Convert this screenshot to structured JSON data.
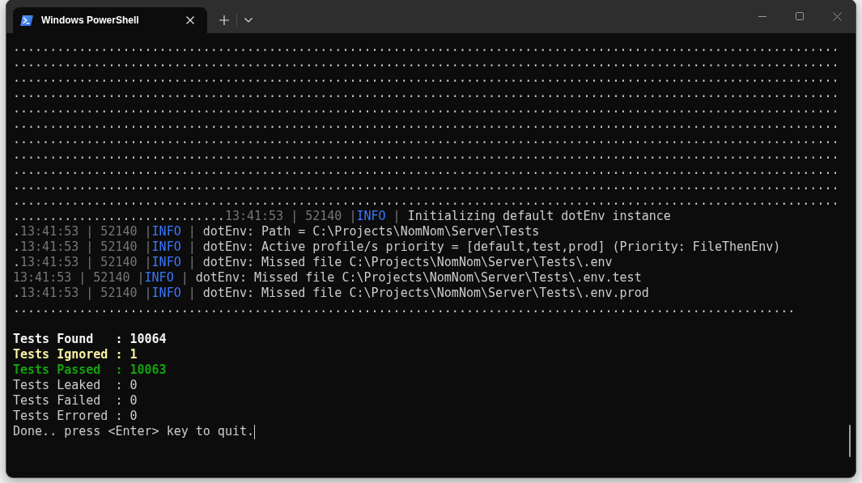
{
  "window": {
    "tab": {
      "title": "Windows PowerShell",
      "selected": true
    }
  },
  "console": {
    "lines": [
      {
        "segments": [
          {
            "kind": "plain",
            "text": "................................................................................................................."
          }
        ]
      },
      {
        "segments": [
          {
            "kind": "plain",
            "text": "................................................................................................................."
          }
        ]
      },
      {
        "segments": [
          {
            "kind": "plain",
            "text": "................................................................................................................."
          }
        ]
      },
      {
        "segments": [
          {
            "kind": "plain",
            "text": "................................................................................................................."
          }
        ]
      },
      {
        "segments": [
          {
            "kind": "plain",
            "text": "................................................................................................................."
          }
        ]
      },
      {
        "segments": [
          {
            "kind": "plain",
            "text": "................................................................................................................."
          }
        ]
      },
      {
        "segments": [
          {
            "kind": "plain",
            "text": "................................................................................................................."
          }
        ]
      },
      {
        "segments": [
          {
            "kind": "plain",
            "text": "................................................................................................................."
          }
        ]
      },
      {
        "segments": [
          {
            "kind": "plain",
            "text": "................................................................................................................."
          }
        ]
      },
      {
        "segments": [
          {
            "kind": "plain",
            "text": "................................................................................................................."
          }
        ]
      },
      {
        "segments": [
          {
            "kind": "plain",
            "text": "................................................................................................................."
          }
        ]
      },
      {
        "segments": [
          {
            "kind": "plain",
            "text": "............................."
          },
          {
            "kind": "dim",
            "text": "13:41:53 | 52140 |"
          },
          {
            "kind": "info",
            "text": "INFO"
          },
          {
            "kind": "dim",
            "text": " | "
          },
          {
            "kind": "plain",
            "text": "Initializing default dotEnv instance"
          }
        ]
      },
      {
        "segments": [
          {
            "kind": "plain",
            "text": "."
          },
          {
            "kind": "dim",
            "text": "13:41:53 | 52140 |"
          },
          {
            "kind": "info",
            "text": "INFO"
          },
          {
            "kind": "dim",
            "text": " | "
          },
          {
            "kind": "plain",
            "text": "dotEnv: Path = C:\\Projects\\NomNom\\Server\\Tests"
          }
        ]
      },
      {
        "segments": [
          {
            "kind": "plain",
            "text": "."
          },
          {
            "kind": "dim",
            "text": "13:41:53 | 52140 |"
          },
          {
            "kind": "info",
            "text": "INFO"
          },
          {
            "kind": "dim",
            "text": " | "
          },
          {
            "kind": "plain",
            "text": "dotEnv: Active profile/s priority = [default,test,prod] (Priority: FileThenEnv)"
          }
        ]
      },
      {
        "segments": [
          {
            "kind": "plain",
            "text": "."
          },
          {
            "kind": "dim",
            "text": "13:41:53 | 52140 |"
          },
          {
            "kind": "info",
            "text": "INFO"
          },
          {
            "kind": "dim",
            "text": " | "
          },
          {
            "kind": "plain",
            "text": "dotEnv: Missed file C:\\Projects\\NomNom\\Server\\Tests\\.env"
          }
        ]
      },
      {
        "segments": [
          {
            "kind": "dim",
            "text": "13:41:53 | 52140 |"
          },
          {
            "kind": "info",
            "text": "INFO"
          },
          {
            "kind": "dim",
            "text": " | "
          },
          {
            "kind": "plain",
            "text": "dotEnv: Missed file C:\\Projects\\NomNom\\Server\\Tests\\.env.test"
          }
        ]
      },
      {
        "segments": [
          {
            "kind": "plain",
            "text": "."
          },
          {
            "kind": "dim",
            "text": "13:41:53 | 52140 |"
          },
          {
            "kind": "info",
            "text": "INFO"
          },
          {
            "kind": "dim",
            "text": " | "
          },
          {
            "kind": "plain",
            "text": "dotEnv: Missed file C:\\Projects\\NomNom\\Server\\Tests\\.env.prod"
          }
        ]
      },
      {
        "segments": [
          {
            "kind": "plain",
            "text": "..........................................................................................................."
          }
        ]
      }
    ],
    "summary": [
      {
        "text": "Tests Found   : 10064",
        "color": "#f2f2f2",
        "bold": true
      },
      {
        "text": "Tests Ignored : 1",
        "color": "#f9f1a5",
        "bold": true
      },
      {
        "text": "Tests Passed  : 10063",
        "color": "#13a10e",
        "bold": true
      },
      {
        "text": "Tests Leaked  : 0",
        "color": "#cccccc",
        "bold": false
      },
      {
        "text": "Tests Failed  : 0",
        "color": "#cccccc",
        "bold": false
      },
      {
        "text": "Tests Errored : 0",
        "color": "#cccccc",
        "bold": false
      }
    ],
    "prompt": "Done.. press <Enter> key to quit."
  }
}
